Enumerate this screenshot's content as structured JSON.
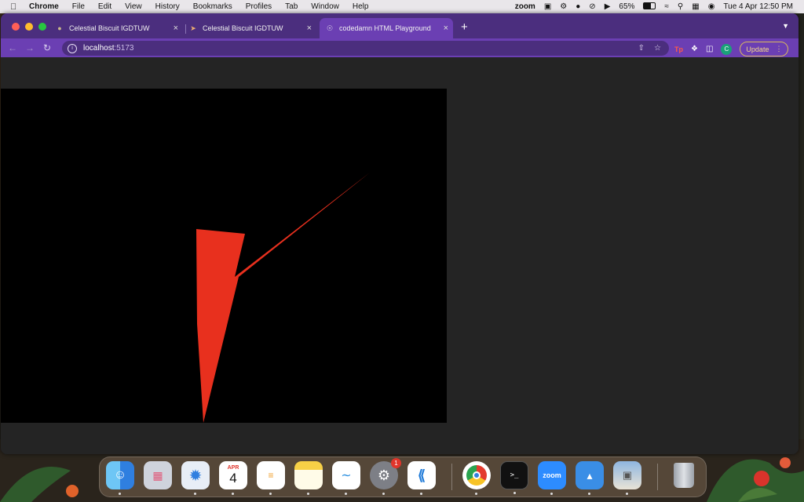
{
  "menubar": {
    "app": "Chrome",
    "menus": [
      "File",
      "Edit",
      "View",
      "History",
      "Bookmarks",
      "Profiles",
      "Tab",
      "Window",
      "Help"
    ],
    "zoom_label": "zoom",
    "battery": "65%",
    "datetime": "Tue 4 Apr  12:50 PM"
  },
  "browser": {
    "tabs": [
      {
        "title": "Celestial Biscuit IGDTUW",
        "icon": "biscuit-icon",
        "active": false
      },
      {
        "title": "Celestial Biscuit IGDTUW",
        "icon": "rocket-icon",
        "active": false
      },
      {
        "title": "codedamn HTML Playground",
        "icon": "globe-icon",
        "active": true
      }
    ],
    "url_host": "localhost",
    "url_port": ":5173",
    "update_label": "Update",
    "avatar_letter": "C",
    "ext_label": "Tp",
    "accent": "#6b3fb3"
  },
  "canvas": {
    "background": "#000000",
    "shape_color": "#e8301e",
    "shape": "checkmark-shape"
  },
  "dock": {
    "calendar_month": "APR",
    "calendar_day": "4",
    "settings_badge": "1",
    "zoom_label": "zoom",
    "apps": [
      "Finder",
      "Launchpad",
      "Safari",
      "Calendar",
      "Reminders",
      "Notes",
      "Freeform",
      "System Settings",
      "Visual Studio Code",
      "Google Chrome",
      "Terminal",
      "Zoom",
      "Keynote",
      "Preview",
      "Trash"
    ]
  }
}
